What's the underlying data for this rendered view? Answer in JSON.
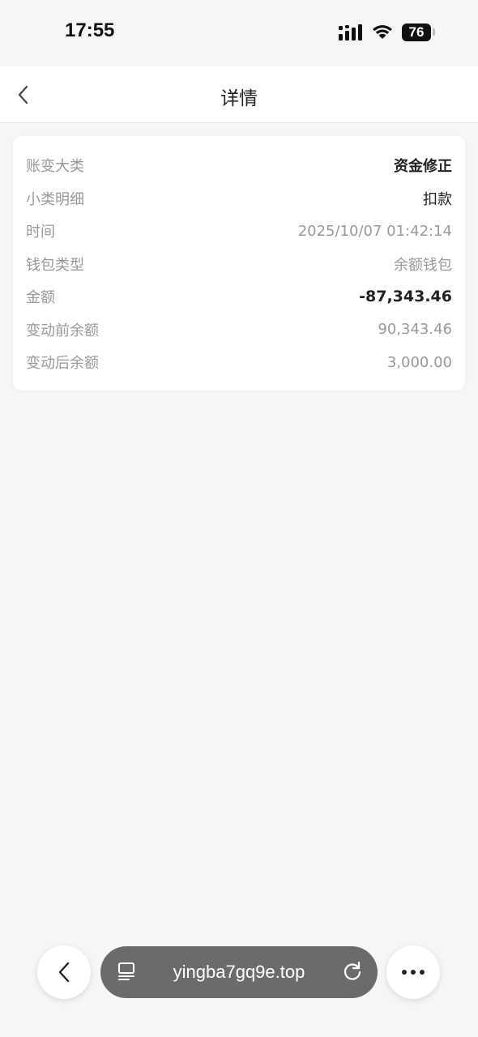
{
  "status_bar": {
    "time": "17:55",
    "battery": "76"
  },
  "nav": {
    "title": "详情"
  },
  "details": [
    {
      "label": "账变大类",
      "value": "资金修正",
      "style": "strong"
    },
    {
      "label": "小类明细",
      "value": "扣款",
      "style": "dark"
    },
    {
      "label": "时间",
      "value": "2025/10/07 01:42:14",
      "style": "muted"
    },
    {
      "label": "钱包类型",
      "value": "余额钱包",
      "style": "muted"
    },
    {
      "label": "金额",
      "value": "-87,343.46",
      "style": "amount"
    },
    {
      "label": "变动前余额",
      "value": "90,343.46",
      "style": "muted"
    },
    {
      "label": "变动后余额",
      "value": "3,000.00",
      "style": "muted"
    }
  ],
  "browser": {
    "url": "yingba7gq9e.top"
  },
  "icons": {
    "nav_back": "chevron-left-icon",
    "browser_back": "chevron-left-icon",
    "tabs": "tabs-icon",
    "reload": "reload-icon",
    "more": "more-dots-icon"
  }
}
